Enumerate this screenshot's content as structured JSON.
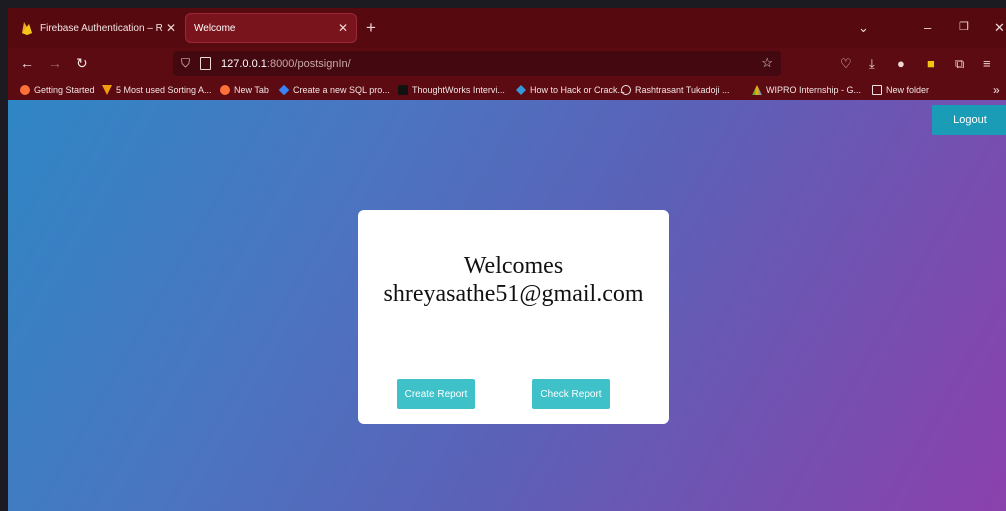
{
  "browser": {
    "tabs": [
      {
        "title": "Firebase Authentication – Realtime",
        "active": false
      },
      {
        "title": "Welcome",
        "active": true
      }
    ],
    "new_tab_symbol": "+",
    "url_host": "127.0.0.1",
    "url_path": ":8000/postsignIn/",
    "bookmarks": [
      {
        "label": "Getting Started"
      },
      {
        "label": "5 Most used Sorting A..."
      },
      {
        "label": "New Tab"
      },
      {
        "label": "Create a new SQL pro..."
      },
      {
        "label": "ThoughtWorks Intervi..."
      },
      {
        "label": "How to Hack or Crack..."
      },
      {
        "label": "Rashtrasant Tukadoji ..."
      },
      {
        "label": "WIPRO Internship - G..."
      },
      {
        "label": "New folder"
      }
    ],
    "overflow_symbol": "»",
    "colors": {
      "frame": "#5a0b12",
      "active_tab": "#7a141c"
    }
  },
  "page": {
    "logout_label": "Logout",
    "welcome_title": "Welcomes",
    "user_email": "shreyasathe51@gmail.com",
    "create_report_label": "Create Report",
    "check_report_label": "Check Report",
    "colors": {
      "button": "#3fc1c9",
      "logout": "#1a9cb6",
      "gradient_start": "#2f86c4",
      "gradient_end": "#8b41ad"
    }
  }
}
